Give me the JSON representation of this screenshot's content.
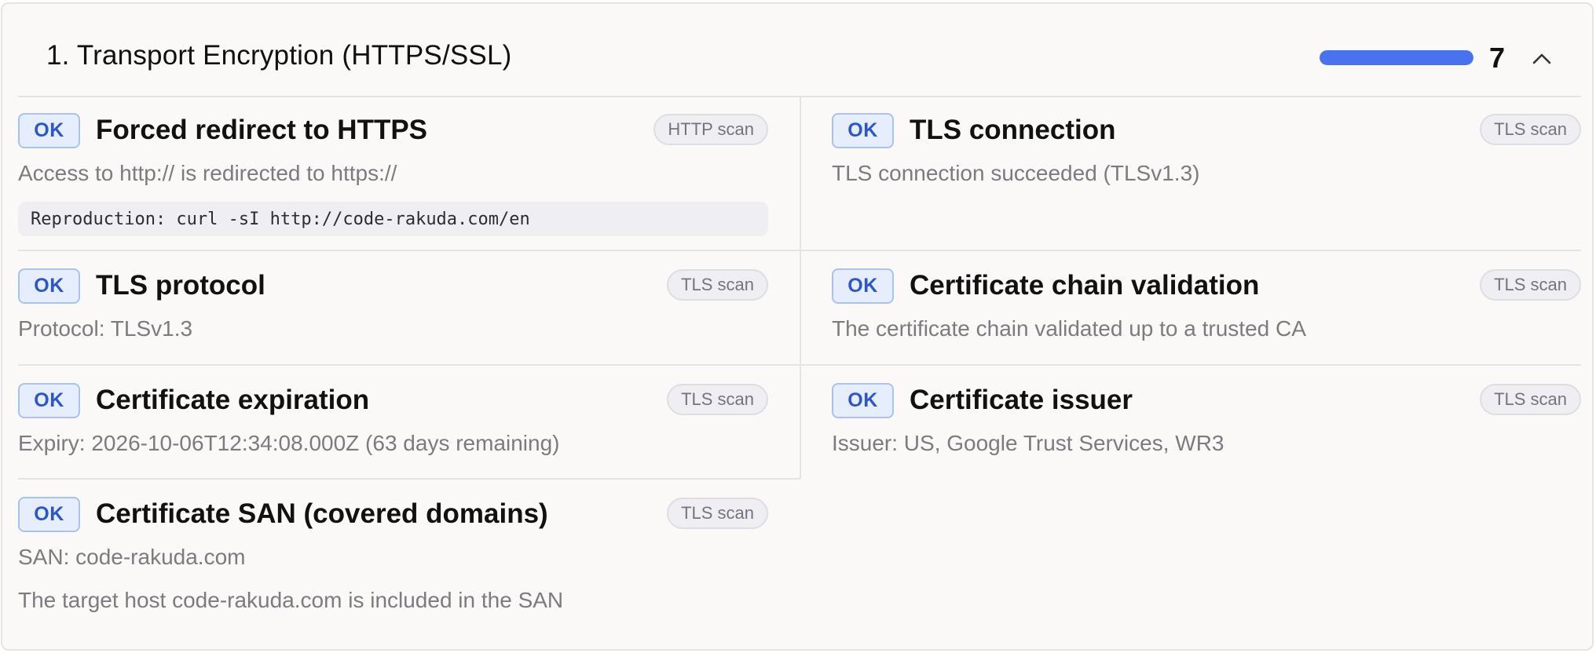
{
  "section": {
    "title": "1. Transport Encryption (HTTPS/SSL)",
    "count": "7",
    "progress_percent": 100,
    "collapse_icon": "chevron-up-icon"
  },
  "colors": {
    "ok_badge_text": "#2d57c9",
    "ok_badge_bg": "#e6edfd",
    "progress": "#4a72ef"
  },
  "checks": [
    {
      "status": "OK",
      "title": "Forced redirect to HTTPS",
      "scan": "HTTP scan",
      "description": "Access to http:// is redirected to https://",
      "code": "Reproduction: curl -sI http://code-rakuda.com/en"
    },
    {
      "status": "OK",
      "title": "TLS connection",
      "scan": "TLS scan",
      "description": "TLS connection succeeded (TLSv1.3)"
    },
    {
      "status": "OK",
      "title": "TLS protocol",
      "scan": "TLS scan",
      "description": "Protocol: TLSv1.3"
    },
    {
      "status": "OK",
      "title": "Certificate chain validation",
      "scan": "TLS scan",
      "description": "The certificate chain validated up to a trusted CA"
    },
    {
      "status": "OK",
      "title": "Certificate expiration",
      "scan": "TLS scan",
      "description": "Expiry: 2026-10-06T12:34:08.000Z (63 days remaining)"
    },
    {
      "status": "OK",
      "title": "Certificate issuer",
      "scan": "TLS scan",
      "description": "Issuer: US, Google Trust Services, WR3"
    },
    {
      "status": "OK",
      "title": "Certificate SAN (covered domains)",
      "scan": "TLS scan",
      "description": "SAN: code-rakuda.com",
      "description2": "The target host code-rakuda.com is included in the SAN"
    }
  ]
}
